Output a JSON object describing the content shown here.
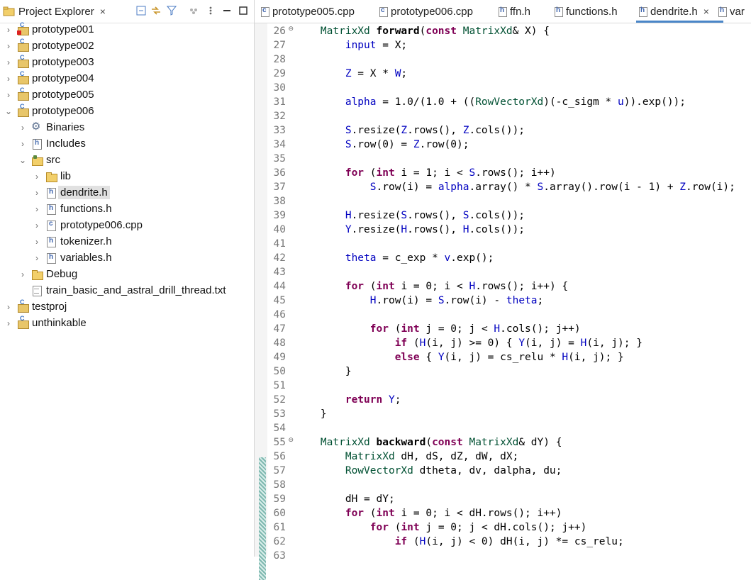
{
  "explorer": {
    "tab_label": "Project Explorer",
    "tab_close": "×",
    "toolbar": [
      "collapse-all-icon",
      "link-with-editor-icon",
      "filter-icon",
      "focus-icon",
      "view-menu-icon",
      "minimize-icon",
      "maximize-icon"
    ],
    "items": [
      {
        "label": "prototype001",
        "icon": "c-project-error-icon",
        "chevron": "›",
        "indent": 0
      },
      {
        "label": "prototype002",
        "icon": "c-project-icon",
        "chevron": "›",
        "indent": 0
      },
      {
        "label": "prototype003",
        "icon": "c-project-icon",
        "chevron": "›",
        "indent": 0
      },
      {
        "label": "prototype004",
        "icon": "c-project-icon",
        "chevron": "›",
        "indent": 0
      },
      {
        "label": "prototype005",
        "icon": "c-project-icon",
        "chevron": "›",
        "indent": 0
      },
      {
        "label": "prototype006",
        "icon": "c-project-icon",
        "chevron": "⌄",
        "indent": 0
      },
      {
        "label": "Binaries",
        "icon": "binaries-icon",
        "chevron": "›",
        "indent": 1
      },
      {
        "label": "Includes",
        "icon": "includes-icon",
        "chevron": "›",
        "indent": 1
      },
      {
        "label": "src",
        "icon": "source-folder-icon",
        "chevron": "⌄",
        "indent": 1
      },
      {
        "label": "lib",
        "icon": "folder-icon",
        "chevron": "›",
        "indent": 2
      },
      {
        "label": "dendrite.h",
        "icon": "header-file-icon",
        "chevron": "›",
        "indent": 2,
        "selected": true
      },
      {
        "label": "functions.h",
        "icon": "header-file-icon",
        "chevron": "›",
        "indent": 2
      },
      {
        "label": "prototype006.cpp",
        "icon": "cpp-file-icon",
        "chevron": "›",
        "indent": 2
      },
      {
        "label": "tokenizer.h",
        "icon": "header-file-icon",
        "chevron": "›",
        "indent": 2
      },
      {
        "label": "variables.h",
        "icon": "header-file-icon",
        "chevron": "›",
        "indent": 2
      },
      {
        "label": "Debug",
        "icon": "folder-icon",
        "chevron": "›",
        "indent": 1
      },
      {
        "label": "train_basic_and_astral_drill_thread.txt",
        "icon": "text-file-icon",
        "chevron": "",
        "indent": 1
      },
      {
        "label": "testproj",
        "icon": "c-project-icon",
        "chevron": "›",
        "indent": 0
      },
      {
        "label": "unthinkable",
        "icon": "c-project-icon",
        "chevron": "›",
        "indent": 0
      }
    ]
  },
  "editor": {
    "tabs": [
      {
        "label": "prototype005.cpp",
        "type": "c"
      },
      {
        "label": "prototype006.cpp",
        "type": "c"
      },
      {
        "label": "ffn.h",
        "type": "h"
      },
      {
        "label": "functions.h",
        "type": "h"
      },
      {
        "label": "dendrite.h",
        "type": "h",
        "active": true,
        "close": "×"
      },
      {
        "label": "var",
        "type": "h"
      }
    ],
    "lines": [
      {
        "n": "26",
        "fold": "⊖",
        "t": [
          [
            "    ",
            ""
          ],
          [
            "MatrixXd",
            "type"
          ],
          [
            " ",
            ""
          ],
          [
            "forward",
            "fn"
          ],
          [
            "(",
            ""
          ],
          [
            "const",
            "kw"
          ],
          [
            " ",
            ""
          ],
          [
            "MatrixXd",
            "type"
          ],
          [
            "& X) {",
            ""
          ]
        ]
      },
      {
        "n": "27",
        "t": [
          [
            "        ",
            ""
          ],
          [
            "input",
            "field"
          ],
          [
            " = X;",
            ""
          ]
        ]
      },
      {
        "n": "28",
        "t": []
      },
      {
        "n": "29",
        "t": [
          [
            "        ",
            ""
          ],
          [
            "Z",
            "field"
          ],
          [
            " = X * ",
            ""
          ],
          [
            "W",
            "field"
          ],
          [
            ";",
            ""
          ]
        ]
      },
      {
        "n": "30",
        "t": []
      },
      {
        "n": "31",
        "t": [
          [
            "        ",
            ""
          ],
          [
            "alpha",
            "field"
          ],
          [
            " = 1.0/(1.0 + ((",
            ""
          ],
          [
            "RowVectorXd",
            "type"
          ],
          [
            ")(-c_sigm * ",
            ""
          ],
          [
            "u",
            "field"
          ],
          [
            ")).exp());",
            ""
          ]
        ]
      },
      {
        "n": "32",
        "t": []
      },
      {
        "n": "33",
        "t": [
          [
            "        ",
            ""
          ],
          [
            "S",
            "field"
          ],
          [
            ".resize(",
            ""
          ],
          [
            "Z",
            "field"
          ],
          [
            ".rows(), ",
            ""
          ],
          [
            "Z",
            "field"
          ],
          [
            ".cols());",
            ""
          ]
        ]
      },
      {
        "n": "34",
        "t": [
          [
            "        ",
            ""
          ],
          [
            "S",
            "field"
          ],
          [
            ".row(0) = ",
            ""
          ],
          [
            "Z",
            "field"
          ],
          [
            ".row(0);",
            ""
          ]
        ]
      },
      {
        "n": "35",
        "t": []
      },
      {
        "n": "36",
        "t": [
          [
            "        ",
            ""
          ],
          [
            "for",
            "kw"
          ],
          [
            " (",
            ""
          ],
          [
            "int",
            "kw"
          ],
          [
            " i = 1; i < ",
            ""
          ],
          [
            "S",
            "field"
          ],
          [
            ".rows(); i++)",
            ""
          ]
        ]
      },
      {
        "n": "37",
        "t": [
          [
            "            ",
            ""
          ],
          [
            "S",
            "field"
          ],
          [
            ".row(i) = ",
            ""
          ],
          [
            "alpha",
            "field"
          ],
          [
            ".array() * ",
            ""
          ],
          [
            "S",
            "field"
          ],
          [
            ".array().row(i - 1) + ",
            ""
          ],
          [
            "Z",
            "field"
          ],
          [
            ".row(i);",
            ""
          ]
        ]
      },
      {
        "n": "38",
        "t": []
      },
      {
        "n": "39",
        "t": [
          [
            "        ",
            ""
          ],
          [
            "H",
            "field"
          ],
          [
            ".resize(",
            ""
          ],
          [
            "S",
            "field"
          ],
          [
            ".rows(), ",
            ""
          ],
          [
            "S",
            "field"
          ],
          [
            ".cols());",
            ""
          ]
        ]
      },
      {
        "n": "40",
        "t": [
          [
            "        ",
            ""
          ],
          [
            "Y",
            "field"
          ],
          [
            ".resize(",
            ""
          ],
          [
            "H",
            "field"
          ],
          [
            ".rows(), ",
            ""
          ],
          [
            "H",
            "field"
          ],
          [
            ".cols());",
            ""
          ]
        ]
      },
      {
        "n": "41",
        "t": []
      },
      {
        "n": "42",
        "t": [
          [
            "        ",
            ""
          ],
          [
            "theta",
            "field"
          ],
          [
            " = c_exp * ",
            ""
          ],
          [
            "v",
            "field"
          ],
          [
            ".exp();",
            ""
          ]
        ]
      },
      {
        "n": "43",
        "t": []
      },
      {
        "n": "44",
        "t": [
          [
            "        ",
            ""
          ],
          [
            "for",
            "kw"
          ],
          [
            " (",
            ""
          ],
          [
            "int",
            "kw"
          ],
          [
            " i = 0; i < ",
            ""
          ],
          [
            "H",
            "field"
          ],
          [
            ".rows(); i++) {",
            ""
          ]
        ]
      },
      {
        "n": "45",
        "t": [
          [
            "            ",
            ""
          ],
          [
            "H",
            "field"
          ],
          [
            ".row(i) = ",
            ""
          ],
          [
            "S",
            "field"
          ],
          [
            ".row(i) - ",
            ""
          ],
          [
            "theta",
            "field"
          ],
          [
            ";",
            ""
          ]
        ]
      },
      {
        "n": "46",
        "t": []
      },
      {
        "n": "47",
        "t": [
          [
            "            ",
            ""
          ],
          [
            "for",
            "kw"
          ],
          [
            " (",
            ""
          ],
          [
            "int",
            "kw"
          ],
          [
            " j = 0; j < ",
            ""
          ],
          [
            "H",
            "field"
          ],
          [
            ".cols(); j++)",
            ""
          ]
        ]
      },
      {
        "n": "48",
        "t": [
          [
            "                ",
            ""
          ],
          [
            "if",
            "kw"
          ],
          [
            " (",
            ""
          ],
          [
            "H",
            "field"
          ],
          [
            "(i, j) >= 0) { ",
            ""
          ],
          [
            "Y",
            "field"
          ],
          [
            "(i, j) = ",
            ""
          ],
          [
            "H",
            "field"
          ],
          [
            "(i, j); }",
            ""
          ]
        ]
      },
      {
        "n": "49",
        "t": [
          [
            "                ",
            ""
          ],
          [
            "else",
            "kw"
          ],
          [
            " { ",
            ""
          ],
          [
            "Y",
            "field"
          ],
          [
            "(i, j) = cs_relu * ",
            ""
          ],
          [
            "H",
            "field"
          ],
          [
            "(i, j); }",
            ""
          ]
        ]
      },
      {
        "n": "50",
        "t": [
          [
            "        }",
            ""
          ]
        ]
      },
      {
        "n": "51",
        "t": []
      },
      {
        "n": "52",
        "t": [
          [
            "        ",
            ""
          ],
          [
            "return",
            "kw"
          ],
          [
            " ",
            ""
          ],
          [
            "Y",
            "field"
          ],
          [
            ";",
            ""
          ]
        ]
      },
      {
        "n": "53",
        "t": [
          [
            "    }",
            ""
          ]
        ]
      },
      {
        "n": "54",
        "t": []
      },
      {
        "n": "55",
        "fold": "⊖",
        "t": [
          [
            "    ",
            ""
          ],
          [
            "MatrixXd",
            "type"
          ],
          [
            " ",
            ""
          ],
          [
            "backward",
            "fn"
          ],
          [
            "(",
            ""
          ],
          [
            "const",
            "kw"
          ],
          [
            " ",
            ""
          ],
          [
            "MatrixXd",
            "type"
          ],
          [
            "& dY) {",
            ""
          ]
        ]
      },
      {
        "n": "56",
        "t": [
          [
            "        ",
            ""
          ],
          [
            "MatrixXd",
            "type"
          ],
          [
            " dH, dS, dZ, dW, dX;",
            ""
          ]
        ]
      },
      {
        "n": "57",
        "t": [
          [
            "        ",
            ""
          ],
          [
            "RowVectorXd",
            "type"
          ],
          [
            " dtheta, dv, dalpha, du;",
            ""
          ]
        ]
      },
      {
        "n": "58",
        "t": []
      },
      {
        "n": "59",
        "t": [
          [
            "        dH = dY;",
            ""
          ]
        ]
      },
      {
        "n": "60",
        "t": [
          [
            "        ",
            ""
          ],
          [
            "for",
            "kw"
          ],
          [
            " (",
            ""
          ],
          [
            "int",
            "kw"
          ],
          [
            " i = 0; i < dH.rows(); i++)",
            ""
          ]
        ]
      },
      {
        "n": "61",
        "t": [
          [
            "            ",
            ""
          ],
          [
            "for",
            "kw"
          ],
          [
            " (",
            ""
          ],
          [
            "int",
            "kw"
          ],
          [
            " j = 0; j < dH.cols(); j++)",
            ""
          ]
        ]
      },
      {
        "n": "62",
        "t": [
          [
            "                ",
            ""
          ],
          [
            "if",
            "kw"
          ],
          [
            " (",
            ""
          ],
          [
            "H",
            "field"
          ],
          [
            "(i, j) < 0) dH(i, j) *= cs_relu;",
            ""
          ]
        ]
      },
      {
        "n": "63",
        "t": []
      }
    ]
  }
}
